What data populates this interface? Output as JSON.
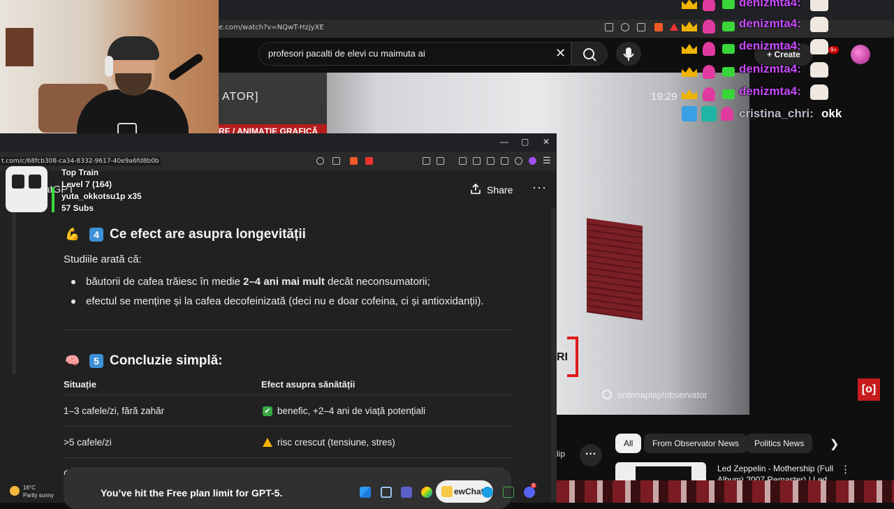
{
  "youtube": {
    "url": "e.com/watch?v=NQwT-HzjyXE",
    "search_query": "profesori pacalti de elevi cu maimuta ai",
    "create_label": "Create",
    "notif_count": "9+",
    "video": {
      "logo_text": "ATOR]",
      "time": "19:29",
      "banner_text": "RE / ANIMAȚIE GRAFICĂ",
      "watermark": "antenaplay/observator",
      "red_text": "RI",
      "corner_icon": "[o]"
    },
    "chips": [
      "All",
      "From Observator News",
      "Politics News"
    ],
    "clip_label": "lip",
    "rec_title": "Led Zeppelin - Mothership (Full Album) 2007 Remaster) | Led"
  },
  "chatgpt": {
    "url": "t.com/c/68fcb308-ca34-8332-9617-40e9a6fd8b0b",
    "brand": "ChatGPT",
    "share_label": "Share",
    "section4": {
      "emoji": "💪",
      "num": "4",
      "title": "Ce efect are asupra longevității",
      "intro": "Studiile arată că:",
      "bullet1_pre": "băutorii de cafea trăiesc în medie ",
      "bullet1_bold": "2–4 ani mai mult",
      "bullet1_post": " decât neconsumatorii;",
      "bullet2": "efectul se menține și la cafea decofeinizată (deci nu e doar cofeina, ci și antioxidanții)."
    },
    "section5": {
      "emoji": "🧠",
      "num": "5",
      "title": "Concluzie simplă:",
      "col1": "Situație",
      "col2": "Efect asupra sănătății",
      "rows": [
        {
          "situatie": "1–3 cafele/zi, fără zahăr",
          "efect": "benefic, +2–4 ani de viață potențiali"
        },
        {
          "situatie": ">5 cafele/zi",
          "efect": "risc crescut (tensiune, stres)"
        }
      ],
      "partial_row": "C"
    },
    "limit_text": "You’ve hit the Free plan limit for GPT-5."
  },
  "train": {
    "title": "Top Train",
    "level": "Level 7  (164)",
    "user": "yuta_okkotsu1p x35",
    "subs": "57 Subs"
  },
  "chat": [
    {
      "name": "denizmta4:"
    },
    {
      "name": "denizmta4:"
    },
    {
      "name": "denizmta4:"
    },
    {
      "name": "denizmta4:"
    },
    {
      "name": "denizmta4:"
    },
    {
      "name": "cristina_chri:",
      "msg": "okk"
    }
  ],
  "taskbar": {
    "temp": "16°C",
    "weather": "Partly sunny",
    "active_app": "ewChat",
    "discord_badge": "5"
  }
}
